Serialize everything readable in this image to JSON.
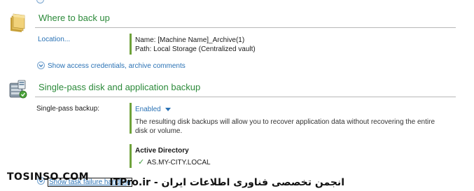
{
  "where_section": {
    "title": "Where to back up",
    "location_link": "Location...",
    "location_name": "Name: [Machine Name]_Archive(1)",
    "location_path": "Path: Local Storage (Centralized vault)",
    "show_credentials_link": "Show access credentials, archive comments"
  },
  "single_pass_section": {
    "title": "Single-pass disk and application backup",
    "field_label": "Single-pass backup:",
    "enabled_value": "Enabled",
    "description": "The resulting disk backups will allow you to recover application data without recovering the entire disk or volume.",
    "ad_heading": "Active Directory",
    "ad_domain": "AS.MY-CITY.LOCAL",
    "show_failure_link": "Show task failure handling"
  },
  "watermark": {
    "left": "TOSINSO.COM",
    "right": "انجمن تخصصی فناوری اطلاعات ایران - ITPro.ir"
  },
  "colors": {
    "section_title": "#2c8a3a",
    "link": "#2a72b5",
    "accent_bar": "#6ea23a"
  },
  "icons": [
    "folder-icon",
    "database-backup-icon",
    "expand-chevron-icon",
    "dropdown-arrow-icon",
    "checkmark-icon"
  ]
}
